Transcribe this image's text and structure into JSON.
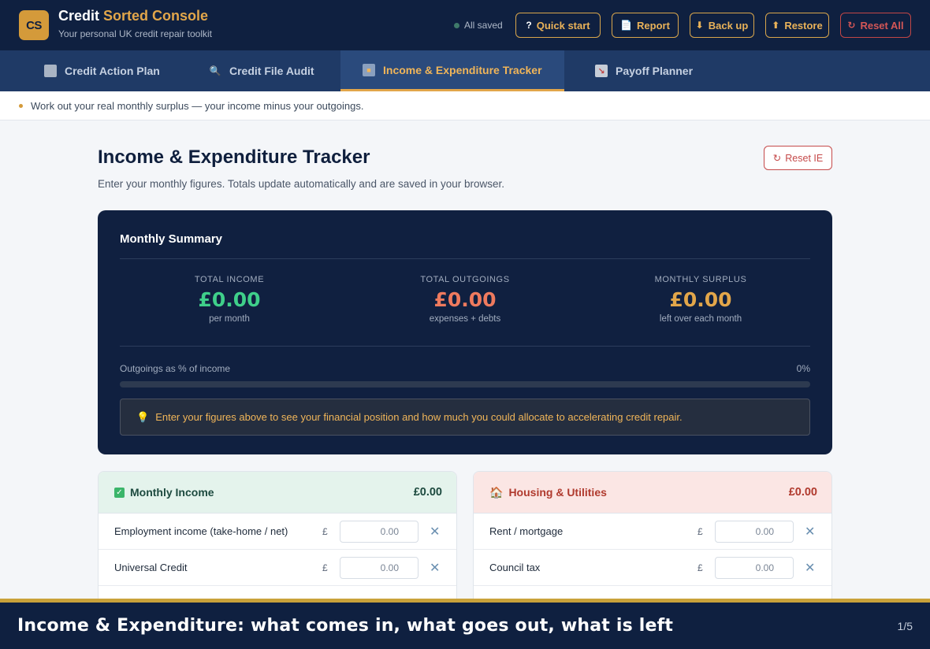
{
  "header": {
    "logo_text": "CS",
    "title_part1": "Credit ",
    "title_part2": "Sorted Console",
    "subtitle": "Your personal UK credit repair toolkit",
    "status": "All saved",
    "buttons": {
      "quick_start": "Quick start",
      "report": "Report",
      "backup": "Back up",
      "restore": "Restore",
      "reset_all": "Reset All"
    }
  },
  "tabs": [
    {
      "label": "Credit Action Plan",
      "icon": "clipboard-icon"
    },
    {
      "label": "Credit File Audit",
      "icon": "magnifier-icon"
    },
    {
      "label": "Income & Expenditure Tracker",
      "icon": "ledger-icon",
      "active": true
    },
    {
      "label": "Payoff Planner",
      "icon": "chart-down-icon"
    }
  ],
  "info_strip": "Work out your real monthly surplus — your income minus your outgoings.",
  "page": {
    "title": "Income & Expenditure Tracker",
    "subtitle": "Enter your monthly figures. Totals update automatically and are saved in your browser.",
    "reset_label": "Reset IE"
  },
  "summary": {
    "title": "Monthly Summary",
    "income": {
      "label": "TOTAL INCOME",
      "value": "£0.00",
      "note": "per month",
      "color": "#3fcf8a"
    },
    "outgoings": {
      "label": "TOTAL OUTGOINGS",
      "value": "£0.00",
      "note": "expenses + debts",
      "color": "#ee7a5e"
    },
    "surplus": {
      "label": "MONTHLY SURPLUS",
      "value": "£0.00",
      "note": "left over each month",
      "color": "#e2a64a"
    },
    "ratio_label": "Outgoings as % of income",
    "ratio_value": "0%",
    "ratio_fraction": 0,
    "tip": "Enter your figures above to see your financial position and how much you could allocate to accelerating credit repair."
  },
  "income_panel": {
    "title": "Monthly Income",
    "total": "£0.00",
    "currency": "£",
    "rows": [
      {
        "label": "Employment income (take-home / net)",
        "placeholder": "0.00"
      },
      {
        "label": "Universal Credit",
        "placeholder": "0.00"
      }
    ]
  },
  "housing_panel": {
    "title": "Housing & Utilities",
    "total": "£0.00",
    "currency": "£",
    "rows": [
      {
        "label": "Rent / mortgage",
        "placeholder": "0.00"
      },
      {
        "label": "Council tax",
        "placeholder": "0.00"
      }
    ]
  },
  "caption": {
    "text": "Income & Expenditure: what comes in, what goes out, what is left",
    "page": "1/5"
  }
}
